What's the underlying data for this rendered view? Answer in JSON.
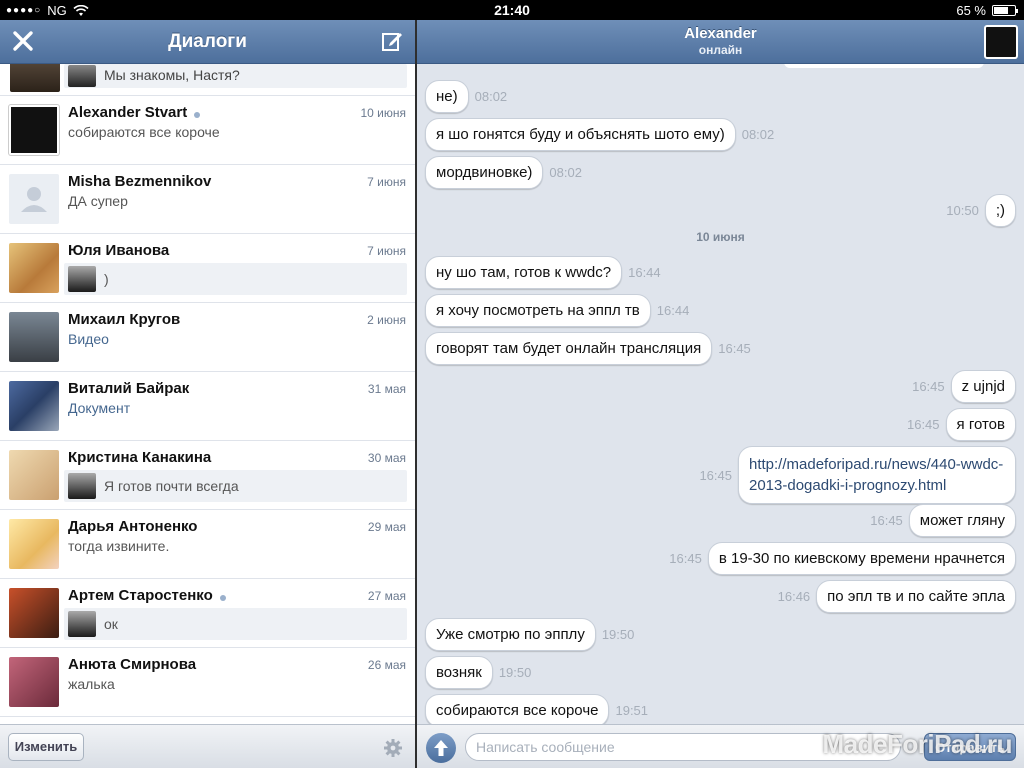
{
  "status_bar": {
    "carrier": "NG",
    "time": "21:40",
    "battery": "65 %",
    "battery_level": 0.65
  },
  "left": {
    "title": "Диалоги",
    "partial_preview": "Мы знакомы, Настя?",
    "dialogs": [
      {
        "name": "Alexander Stvart",
        "online": true,
        "date": "10 июня",
        "preview": "собираются все короче",
        "mine": false,
        "link": false
      },
      {
        "name": "Misha Bezmennikov",
        "online": false,
        "date": "7 июня",
        "preview": "ДА супер",
        "mine": false,
        "link": false
      },
      {
        "name": "Юля Иванова",
        "online": false,
        "date": "7 июня",
        "preview": ")",
        "mine": true,
        "link": false
      },
      {
        "name": "Михаил Кругов",
        "online": false,
        "date": "2 июня",
        "preview": "Видео",
        "mine": false,
        "link": true
      },
      {
        "name": "Виталий Байрак",
        "online": false,
        "date": "31 мая",
        "preview": "Документ",
        "mine": false,
        "link": true
      },
      {
        "name": "Кристина Канакина",
        "online": false,
        "date": "30 мая",
        "preview": "Я готов почти всегда",
        "mine": true,
        "link": false
      },
      {
        "name": "Дарья Антоненко",
        "online": false,
        "date": "29 мая",
        "preview": "тогда извините.",
        "mine": false,
        "link": false
      },
      {
        "name": "Артем Старостенко",
        "online": true,
        "date": "27 мая",
        "preview": "ок",
        "mine": true,
        "link": false
      },
      {
        "name": "Анюта Смирнова",
        "online": false,
        "date": "26 мая",
        "preview": "жалька",
        "mine": false,
        "link": false
      }
    ],
    "edit_label": "Изменить"
  },
  "chat": {
    "title": "Alexander",
    "subtitle": "онлайн",
    "date_separator": "10 июня",
    "messages": [
      {
        "dir": "in",
        "text": "не)",
        "time": "08:02"
      },
      {
        "dir": "in",
        "text": "я шо гонятся буду и объяснять шото ему)",
        "time": "08:02"
      },
      {
        "dir": "in",
        "text": "мордвиновке)",
        "time": "08:02"
      },
      {
        "dir": "out",
        "text": ";)",
        "time": "10:50"
      },
      {
        "dir": "in",
        "text": "ну шо там, готов к wwdc?",
        "time": "16:44"
      },
      {
        "dir": "in",
        "text": "я хочу посмотреть на эппл тв",
        "time": "16:44"
      },
      {
        "dir": "in",
        "text": "говорят там будет онлайн трансляция",
        "time": "16:45"
      },
      {
        "dir": "out",
        "text": "z ujnjd",
        "time": "16:45"
      },
      {
        "dir": "out",
        "text": "я готов",
        "time": "16:45"
      },
      {
        "dir": "out",
        "text": "http://madeforipad.ru/news/440-wwdc-2013-dogadki-i-prognozy.html",
        "time": "16:45"
      },
      {
        "dir": "out",
        "text": "может гляну",
        "time": "16:45"
      },
      {
        "dir": "out",
        "text": "в 19-30 по киевскому времени нрачнется",
        "time": "16:45"
      },
      {
        "dir": "out",
        "text": "по эпл тв и по сайте эпла",
        "time": "16:46"
      },
      {
        "dir": "in",
        "text": "Уже смотрю по эпплу",
        "time": "19:50"
      },
      {
        "dir": "in",
        "text": "возняк",
        "time": "19:50"
      },
      {
        "dir": "in",
        "text": "собираются все короче",
        "time": "19:51"
      }
    ],
    "input_placeholder": "Написать сообщение",
    "send_label": "Отправить",
    "watermark": "MadeForiPad.ru"
  }
}
